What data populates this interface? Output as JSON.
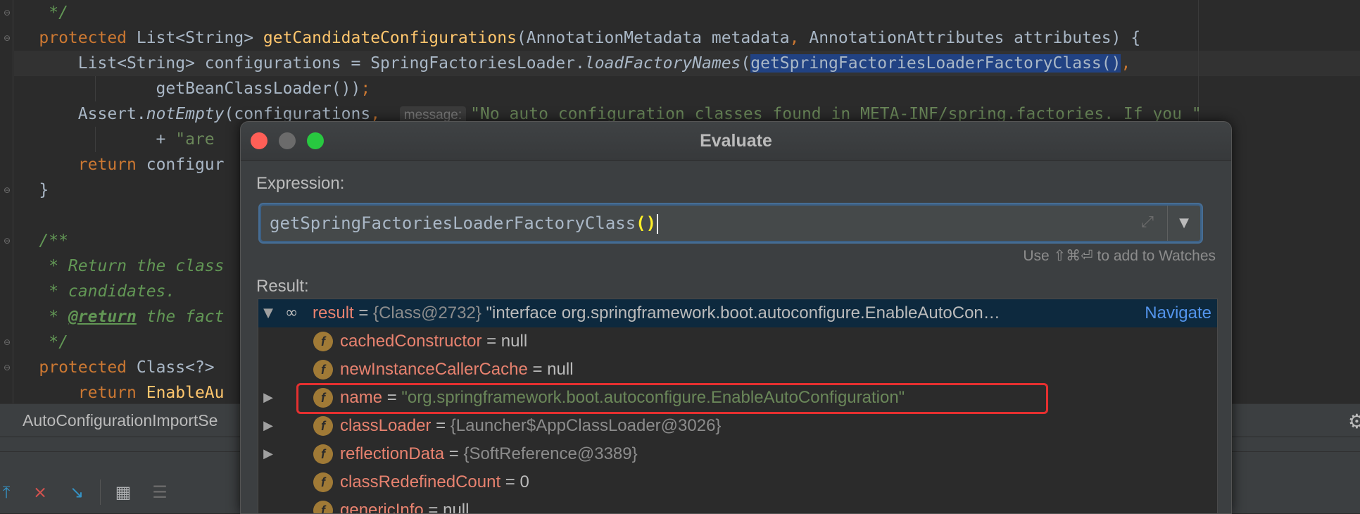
{
  "editor": {
    "lines": [
      {
        "parts": [
          {
            "t": "     */",
            "c": "cm"
          }
        ]
      },
      {
        "parts": [
          {
            "t": "    ",
            "c": ""
          },
          {
            "t": "protected ",
            "c": "kw"
          },
          {
            "t": "List<String> ",
            "c": ""
          },
          {
            "t": "getCandidateConfigurations",
            "c": "fn"
          },
          {
            "t": "(AnnotationMetadata metadata",
            "c": ""
          },
          {
            "t": ", ",
            "c": "kw"
          },
          {
            "t": "AnnotationAttributes attributes) {",
            "c": ""
          }
        ]
      },
      {
        "parts": [
          {
            "t": "        List<String> configurations = SpringFactoriesLoader.",
            "c": ""
          },
          {
            "t": "loadFactoryNames",
            "c": "it"
          },
          {
            "t": "(",
            "c": ""
          },
          {
            "t": "getSpringFactoriesLoaderFactoryClass()",
            "c": "sel"
          },
          {
            "t": ",",
            "c": "kw"
          }
        ]
      },
      {
        "parts": [
          {
            "t": "                getBeanClassLoader())",
            "c": ""
          },
          {
            "t": ";",
            "c": "kw"
          }
        ]
      },
      {
        "parts": [
          {
            "t": "        Assert.",
            "c": ""
          },
          {
            "t": "notEmpty",
            "c": "it"
          },
          {
            "t": "(configurations",
            "c": ""
          },
          {
            "t": ",  ",
            "c": "kw"
          },
          {
            "t": "message:",
            "c": "hint"
          },
          {
            "t": "\"No auto configuration classes found in META-INF/spring.factories. If you \"",
            "c": "str"
          }
        ]
      },
      {
        "parts": [
          {
            "t": "                + ",
            "c": ""
          },
          {
            "t": "\"are",
            "c": "str"
          }
        ]
      },
      {
        "parts": [
          {
            "t": "        ",
            "c": ""
          },
          {
            "t": "return ",
            "c": "kw"
          },
          {
            "t": "configur",
            "c": ""
          }
        ]
      },
      {
        "parts": [
          {
            "t": "    }",
            "c": ""
          }
        ]
      },
      {
        "parts": [
          {
            "t": "",
            "c": ""
          }
        ]
      },
      {
        "parts": [
          {
            "t": "    /**",
            "c": "cm"
          }
        ]
      },
      {
        "parts": [
          {
            "t": "     * Return the class",
            "c": "cm"
          }
        ]
      },
      {
        "parts": [
          {
            "t": "     * candidates.",
            "c": "cm"
          }
        ]
      },
      {
        "parts": [
          {
            "t": "     * ",
            "c": "cm"
          },
          {
            "t": "@return",
            "c": "cmtag"
          },
          {
            "t": " the fact",
            "c": "cm"
          }
        ]
      },
      {
        "parts": [
          {
            "t": "     */",
            "c": "cm"
          }
        ]
      },
      {
        "parts": [
          {
            "t": "    ",
            "c": ""
          },
          {
            "t": "protected ",
            "c": "kw"
          },
          {
            "t": "Class<?>",
            "c": ""
          }
        ]
      },
      {
        "parts": [
          {
            "t": "        ",
            "c": ""
          },
          {
            "t": "return ",
            "c": "kw"
          },
          {
            "t": "EnableAu",
            "c": "fn"
          }
        ]
      }
    ]
  },
  "bottom_tab": {
    "label": "AutoConfigurationImportSe"
  },
  "toolbar": {
    "icons": [
      "step-out-icon",
      "drop-frame-icon",
      "run-to-cursor-icon",
      "evaluate-table-icon",
      "trace-icon"
    ]
  },
  "dialog": {
    "title": "Evaluate",
    "expression_label": "Expression:",
    "expression_value_prefix": "getSpringFactoriesLoaderFactoryClass",
    "expression_value_parens": "()",
    "watch_hint": "Use ⇧⌘⏎ to add to Watches",
    "result_label": "Result:",
    "colors": {
      "close": "#ff5f57",
      "minimize": "#6b6b6b",
      "zoom": "#28c840",
      "highlight_box": "#e53030"
    },
    "result_tree": [
      {
        "expanded": true,
        "icon": "watch-glasses-icon",
        "name": "result",
        "sep": " = ",
        "obj": "{Class@2732} ",
        "value": "\"interface org.springframework.boot.autoconfigure.EnableAutoCon",
        "ellipsis": "…",
        "link": "Navigate",
        "selected": true
      },
      {
        "icon": "field-icon",
        "icon_letter": "f",
        "name": "cachedConstructor",
        "sep": " = ",
        "value": "null",
        "kind": "plain"
      },
      {
        "icon": "field-icon",
        "icon_letter": "f",
        "name": "newInstanceCallerCache",
        "sep": " = ",
        "value": "null",
        "kind": "plain"
      },
      {
        "expandable": true,
        "icon": "field-icon",
        "icon_letter": "f",
        "name": "name",
        "sep": " = ",
        "value": "\"org.springframework.boot.autoconfigure.EnableAutoConfiguration\"",
        "kind": "str",
        "highlighted": true
      },
      {
        "expandable": true,
        "icon": "field-icon",
        "icon_letter": "f",
        "name": "classLoader",
        "sep": " = ",
        "value": "{Launcher$AppClassLoader@3026}",
        "kind": "obj"
      },
      {
        "expandable": true,
        "icon": "field-icon",
        "icon_letter": "f",
        "name": "reflectionData",
        "sep": " = ",
        "value": "{SoftReference@3389}",
        "kind": "obj"
      },
      {
        "icon": "field-icon",
        "icon_letter": "f",
        "name": "classRedefinedCount",
        "sep": " = ",
        "value": "0",
        "kind": "plain"
      },
      {
        "icon": "field-icon",
        "icon_letter": "f",
        "name": "genericInfo",
        "sep": " = ",
        "value": "null",
        "kind": "plain"
      }
    ]
  }
}
